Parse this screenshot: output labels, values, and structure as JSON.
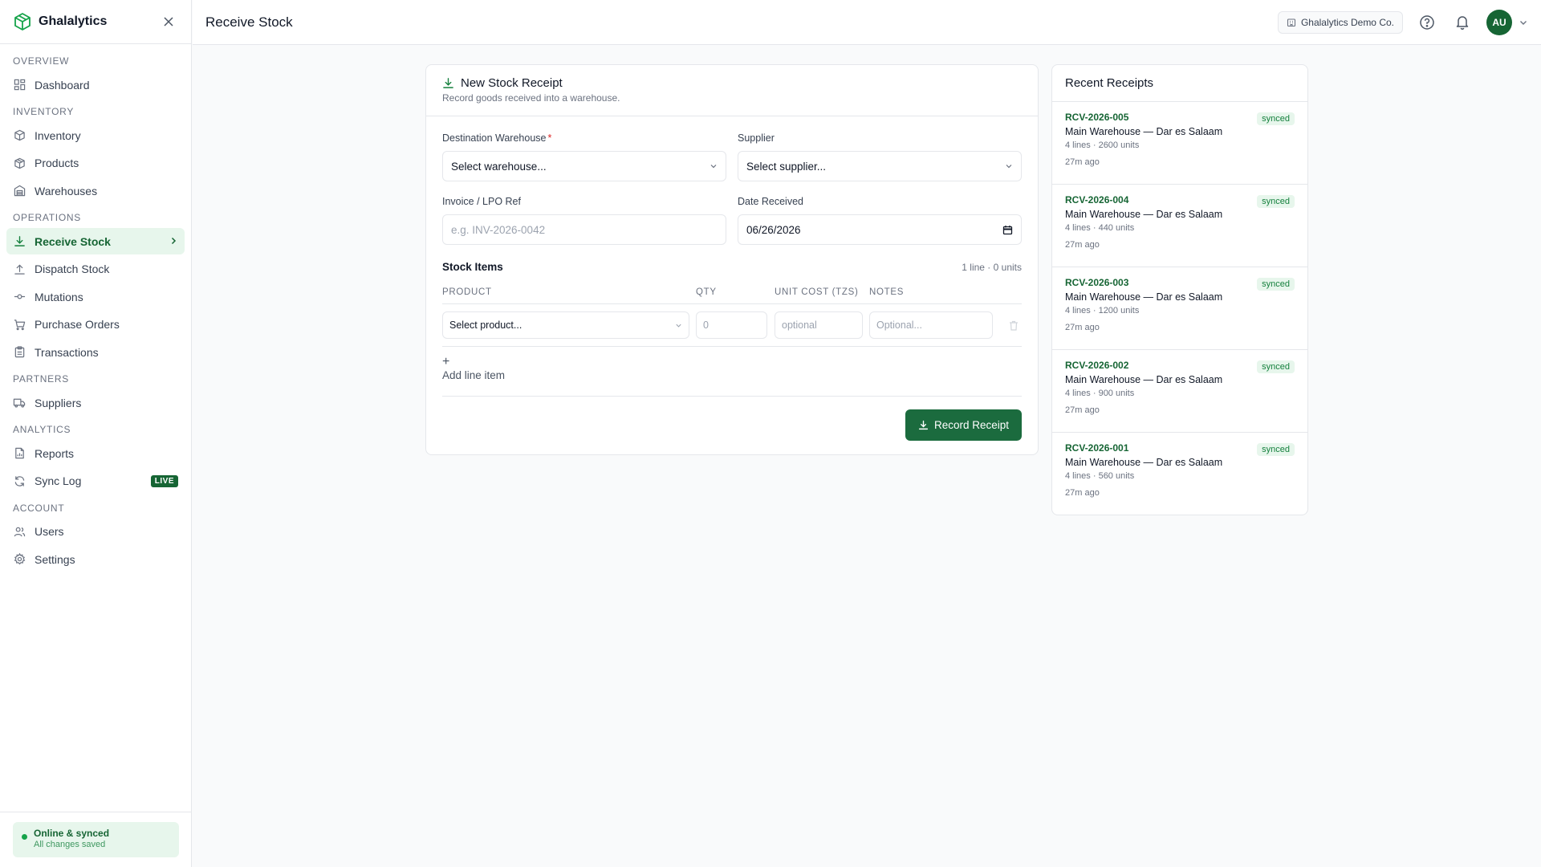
{
  "brand": {
    "name": "Ghalalytics"
  },
  "sidebar": {
    "sections": [
      {
        "label": "OVERVIEW",
        "items": [
          {
            "label": "Dashboard",
            "icon": "dashboard-icon"
          }
        ]
      },
      {
        "label": "INVENTORY",
        "items": [
          {
            "label": "Inventory",
            "icon": "cube-icon"
          },
          {
            "label": "Products",
            "icon": "boxes-icon"
          },
          {
            "label": "Warehouses",
            "icon": "warehouse-icon"
          }
        ]
      },
      {
        "label": "OPERATIONS",
        "items": [
          {
            "label": "Receive Stock",
            "icon": "download-icon",
            "active": true
          },
          {
            "label": "Dispatch Stock",
            "icon": "upload-icon"
          },
          {
            "label": "Mutations",
            "icon": "commit-icon"
          },
          {
            "label": "Purchase Orders",
            "icon": "cart-icon"
          },
          {
            "label": "Transactions",
            "icon": "clipboard-icon"
          }
        ]
      },
      {
        "label": "PARTNERS",
        "items": [
          {
            "label": "Suppliers",
            "icon": "truck-icon"
          }
        ]
      },
      {
        "label": "ANALYTICS",
        "items": [
          {
            "label": "Reports",
            "icon": "report-icon"
          },
          {
            "label": "Sync Log",
            "icon": "sync-icon",
            "badge": "LIVE"
          }
        ]
      },
      {
        "label": "ACCOUNT",
        "items": [
          {
            "label": "Users",
            "icon": "users-icon"
          },
          {
            "label": "Settings",
            "icon": "gear-icon"
          }
        ]
      }
    ],
    "status": {
      "title": "Online & synced",
      "subtitle": "All changes saved"
    }
  },
  "header": {
    "title": "Receive Stock",
    "org": "Ghalalytics Demo Co.",
    "avatar_initials": "AU"
  },
  "form": {
    "title": "New Stock Receipt",
    "subtitle": "Record goods received into a warehouse.",
    "warehouse_label": "Destination Warehouse",
    "warehouse_required": "*",
    "warehouse_value": "Select warehouse...",
    "supplier_label": "Supplier",
    "supplier_value": "Select supplier...",
    "invoice_label": "Invoice / LPO Ref",
    "invoice_placeholder": "e.g. INV-2026-0042",
    "date_label": "Date Received",
    "date_value": "06/26/2026",
    "items_title": "Stock Items",
    "items_count": "1 line · 0 units",
    "columns": {
      "product": "PRODUCT",
      "qty": "QTY",
      "cost": "UNIT COST (TZS)",
      "notes": "NOTES"
    },
    "row": {
      "product": "Select product...",
      "qty_placeholder": "0",
      "cost_placeholder": "optional",
      "notes_placeholder": "Optional..."
    },
    "add_line": "Add line item",
    "submit": "Record Receipt"
  },
  "recent": {
    "title": "Recent Receipts",
    "items": [
      {
        "id": "RCV-2026-005",
        "warehouse": "Main Warehouse — Dar es Salaam",
        "meta": "4 lines · 2600 units",
        "time": "27m ago",
        "status": "synced"
      },
      {
        "id": "RCV-2026-004",
        "warehouse": "Main Warehouse — Dar es Salaam",
        "meta": "4 lines · 440 units",
        "time": "27m ago",
        "status": "synced"
      },
      {
        "id": "RCV-2026-003",
        "warehouse": "Main Warehouse — Dar es Salaam",
        "meta": "4 lines · 1200 units",
        "time": "27m ago",
        "status": "synced"
      },
      {
        "id": "RCV-2026-002",
        "warehouse": "Main Warehouse — Dar es Salaam",
        "meta": "4 lines · 900 units",
        "time": "27m ago",
        "status": "synced"
      },
      {
        "id": "RCV-2026-001",
        "warehouse": "Main Warehouse — Dar es Salaam",
        "meta": "4 lines · 560 units",
        "time": "27m ago",
        "status": "synced"
      }
    ]
  },
  "colors": {
    "accent": "#166534",
    "accent_light": "#e7f6ec",
    "primary_button": "#1b6b3e"
  }
}
